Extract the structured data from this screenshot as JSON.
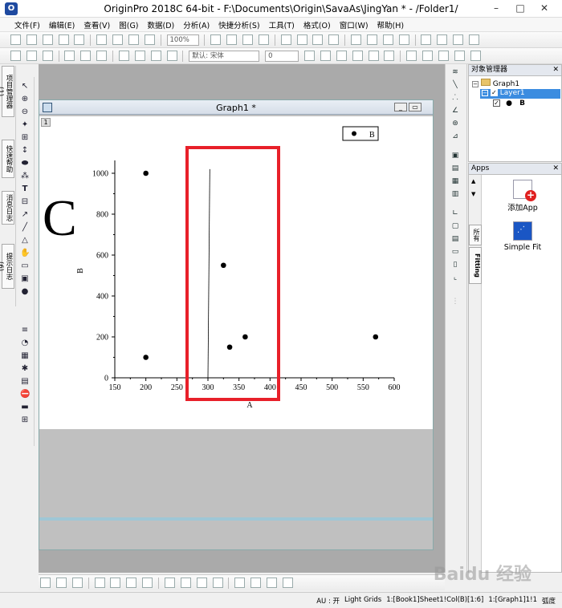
{
  "window": {
    "title": "OriginPro 2018C 64-bit - F:\\Documents\\Origin\\SavaAs\\JingYan * - /Folder1/",
    "controls": [
      "–",
      "□",
      "✕"
    ]
  },
  "menu": [
    "文件(F)",
    "编辑(E)",
    "查看(V)",
    "图(G)",
    "数据(D)",
    "分析(A)",
    "快捷分析(S)",
    "工具(T)",
    "格式(O)",
    "窗口(W)",
    "帮助(H)"
  ],
  "toolbar": {
    "zoom": "100%",
    "font": "默认: 宋体",
    "font_size": "0"
  },
  "left_tabs": [
    "项目管理器 (1)",
    "快速帮助",
    "消息日志",
    "提示日志 (6)"
  ],
  "graph_window": {
    "title": "Graph1 *",
    "layer": "1",
    "panel_letter": "C"
  },
  "chart_data": {
    "type": "scatter",
    "series": [
      {
        "name": "B",
        "x": [
          200,
          200,
          325,
          335,
          360,
          570
        ],
        "y": [
          1000,
          100,
          550,
          150,
          200,
          200
        ]
      }
    ],
    "line": {
      "x": [
        300,
        303
      ],
      "y": [
        0,
        1020
      ]
    },
    "xlabel": "A",
    "ylabel": "B",
    "xlim": [
      150,
      600
    ],
    "ylim": [
      0,
      1000
    ],
    "xticks": [
      150,
      200,
      250,
      300,
      350,
      400,
      450,
      500,
      550,
      600
    ],
    "yticks": [
      0,
      200,
      400,
      600,
      800,
      1000
    ],
    "legend": "top-right",
    "highlight_color": "#e8202a"
  },
  "object_manager": {
    "title": "对象管理器",
    "tree": [
      "Graph1",
      "Layer1",
      "B"
    ]
  },
  "apps": {
    "title": "Apps",
    "side_tabs": [
      "所有",
      "Fitting"
    ],
    "items": [
      "添加App",
      "Simple Fit"
    ]
  },
  "statusbar": [
    "AU : 开",
    "Light Grids",
    "1:[Book1]Sheet1!Col(B)[1:6]",
    "1:[Graph1]1!1",
    "弧度"
  ],
  "watermark": "Baidu 经验"
}
